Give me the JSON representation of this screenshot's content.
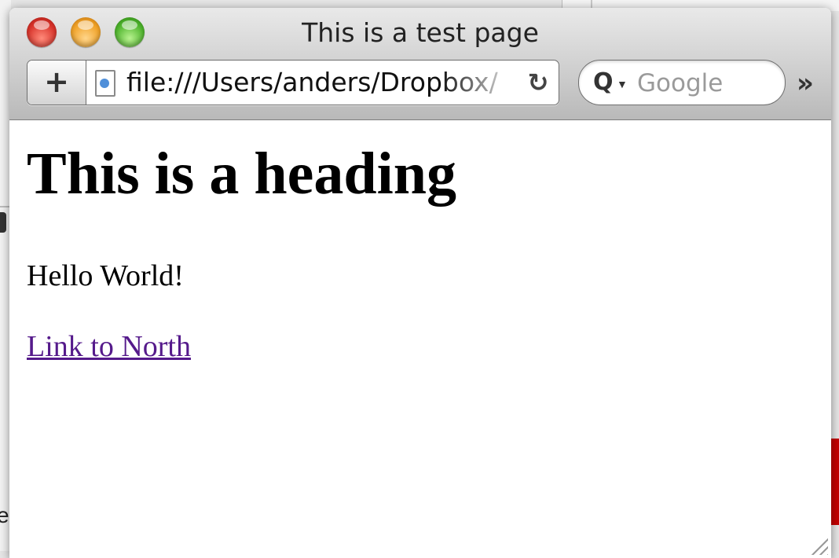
{
  "window": {
    "title": "This is a test page"
  },
  "toolbar": {
    "add_button_label": "+",
    "url": "file:///Users/anders/Dropbox/",
    "reload_label": "↻",
    "search_placeholder": "Google",
    "overflow_label": "»"
  },
  "page": {
    "heading": "This is a heading",
    "paragraph": "Hello World!",
    "link_text": "Link to North"
  },
  "background": {
    "left_edge_text": "e"
  },
  "colors": {
    "link_visited": "#551a8b",
    "close_button": "#d8332a",
    "minimize_button": "#f0a228",
    "zoom_button": "#4eb42c"
  }
}
